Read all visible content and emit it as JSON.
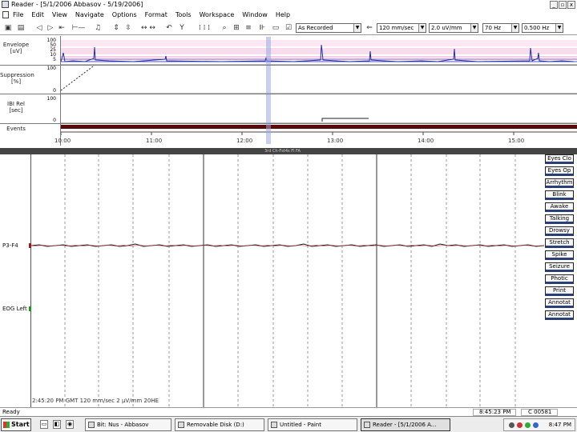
{
  "window": {
    "title": "Reader - [5/1/2006 Abbasov - 5/19/2006]",
    "controls": [
      "_",
      "▫",
      "x"
    ]
  },
  "menu": {
    "items": [
      "File",
      "Edit",
      "View",
      "Navigate",
      "Options",
      "Format",
      "Tools",
      "Workspace",
      "Window",
      "Help"
    ]
  },
  "toolbar": {
    "montage_select": "As Recorded",
    "timebase_select": "120 mm/sec",
    "sensitivity_select": "2.0 uV/mm",
    "lff_select": "70 Hz",
    "hff_select": "0.500 Hz"
  },
  "trend": {
    "panels": [
      {
        "label": [
          "Envelope",
          "[uV]"
        ],
        "ticks": [
          "100",
          "50",
          "25",
          "10",
          "5"
        ]
      },
      {
        "label": [
          "Suppression",
          "[%]"
        ],
        "ticks": [
          "100",
          "0"
        ]
      },
      {
        "label": [
          "IBI Rel",
          "[sec]"
        ],
        "ticks": [
          "100",
          "0"
        ]
      },
      {
        "label": [
          "Events"
        ],
        "ticks": []
      }
    ],
    "time_axis": [
      "10:00",
      "11:00",
      "12:00",
      "13:00",
      "14:00",
      "15:00"
    ]
  },
  "eeg": {
    "strip_text_center": "3rd Ch-Fst4s Fl FA",
    "channels": [
      {
        "label": "P3-F4",
        "mark_color": "#a01818"
      },
      {
        "label": "EOG Left",
        "mark_color": "#189a18"
      }
    ],
    "info": "2:45:20 PM GMT 120 mm/sec 2 µV/mm 20HE"
  },
  "event_buttons": [
    "Eyes Clo",
    "Eyes Op",
    "Arrhythm",
    "Blink",
    "Awake",
    "Talking",
    "Drowsy",
    "Stretch",
    "Spike",
    "Seizure",
    "Photic",
    "Print",
    "Annotat",
    "Annotat"
  ],
  "status": {
    "left": "Ready",
    "time": "8:45:23 PM",
    "count": "C 00581"
  },
  "taskbar": {
    "start_label": "Start",
    "tasks": [
      "Bit: Nus - Abbasov",
      "Removable Disk (D:)",
      "Untitled - Paint",
      "Reader - [5/1/2006 A..."
    ],
    "clock": "8:47 PM"
  }
}
